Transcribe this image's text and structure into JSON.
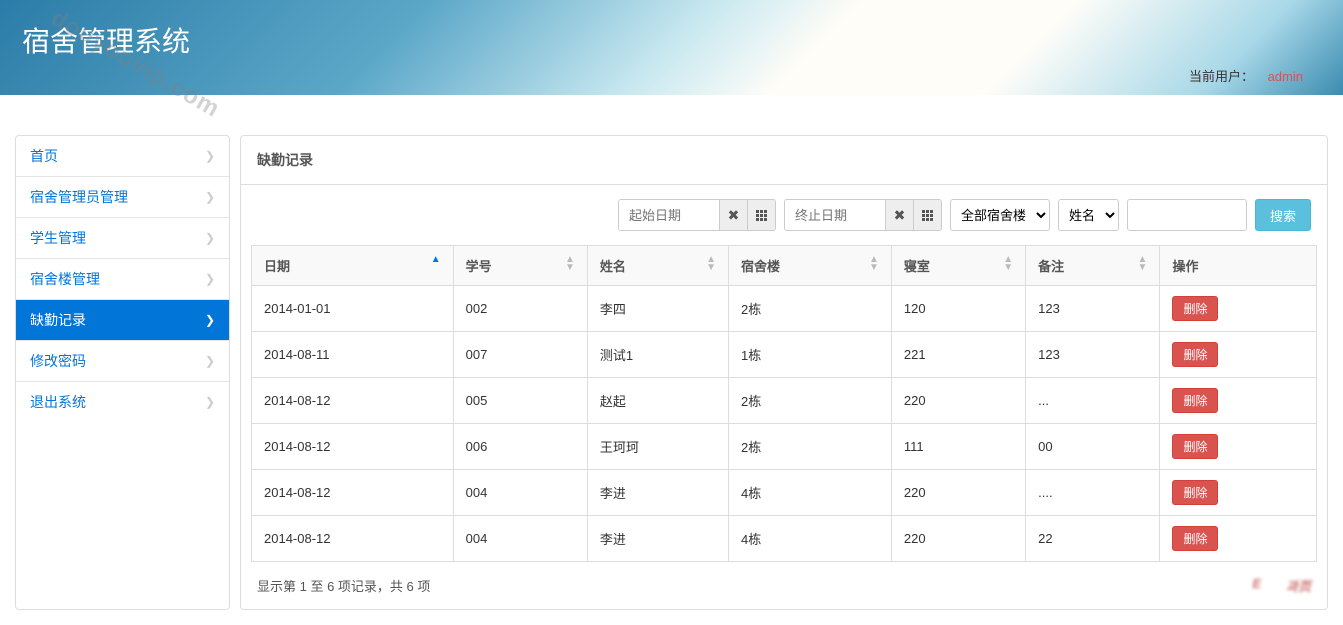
{
  "header": {
    "title": "宿舍管理系统",
    "current_user_label": "当前用户：",
    "current_user_name": "admin",
    "watermark": "douyouvip.com"
  },
  "sidebar": {
    "items": [
      {
        "label": "首页",
        "active": false
      },
      {
        "label": "宿舍管理员管理",
        "active": false
      },
      {
        "label": "学生管理",
        "active": false
      },
      {
        "label": "宿舍楼管理",
        "active": false
      },
      {
        "label": "缺勤记录",
        "active": true
      },
      {
        "label": "修改密码",
        "active": false
      },
      {
        "label": "退出系统",
        "active": false
      }
    ]
  },
  "panel": {
    "title": "缺勤记录"
  },
  "toolbar": {
    "start_date_placeholder": "起始日期",
    "end_date_placeholder": "终止日期",
    "building_select": "全部宿舍楼",
    "field_select": "姓名",
    "search_label": "搜索"
  },
  "table": {
    "columns": [
      "日期",
      "学号",
      "姓名",
      "宿舍楼",
      "寝室",
      "备注",
      "操作"
    ],
    "sorted_column": 0,
    "rows": [
      {
        "date": "2014-01-01",
        "sid": "002",
        "name": "李四",
        "building": "2栋",
        "room": "120",
        "note": "123"
      },
      {
        "date": "2014-08-11",
        "sid": "007",
        "name": "测试1",
        "building": "1栋",
        "room": "221",
        "note": "123"
      },
      {
        "date": "2014-08-12",
        "sid": "005",
        "name": "赵起",
        "building": "2栋",
        "room": "220",
        "note": "..."
      },
      {
        "date": "2014-08-12",
        "sid": "006",
        "name": "王珂珂",
        "building": "2栋",
        "room": "111",
        "note": "00"
      },
      {
        "date": "2014-08-12",
        "sid": "004",
        "name": "李进",
        "building": "4栋",
        "room": "220",
        "note": "...."
      },
      {
        "date": "2014-08-12",
        "sid": "004",
        "name": "李进",
        "building": "4栋",
        "room": "220",
        "note": "22"
      }
    ],
    "delete_label": "删除",
    "info": "显示第 1 至 6 项记录，共 6 项"
  }
}
